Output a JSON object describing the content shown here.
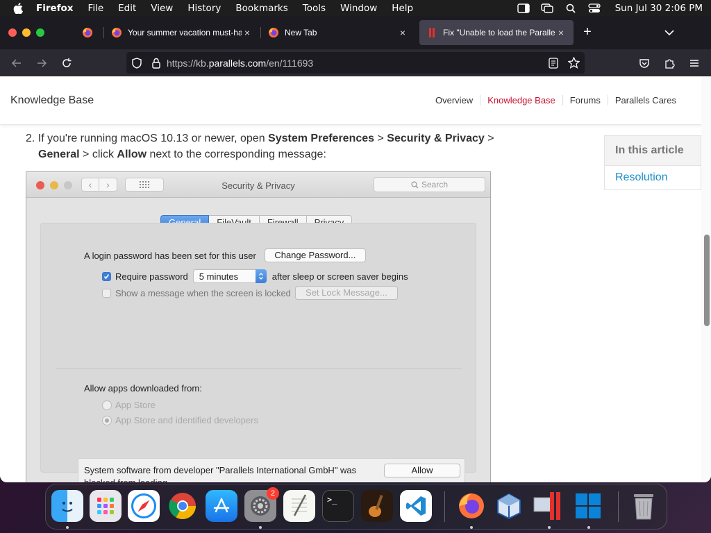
{
  "menubar": {
    "app_name": "Firefox",
    "items": [
      "File",
      "Edit",
      "View",
      "History",
      "Bookmarks",
      "Tools",
      "Window",
      "Help"
    ],
    "clock": "Sun Jul 30  2:06 PM"
  },
  "browser": {
    "tabs": [
      {
        "title": "Your summer vacation must-hav",
        "active": false
      },
      {
        "title": "New Tab",
        "active": false
      },
      {
        "title": "Fix \"Unable to load the Parallels",
        "active": true
      }
    ],
    "new_tab_symbol": "+",
    "tab_close_symbol": "×",
    "url": {
      "prefix": "https://kb.",
      "host": "parallels.com",
      "path": "/en/111693"
    }
  },
  "site": {
    "title": "Knowledge Base",
    "nav": [
      {
        "label": "Overview",
        "active": false
      },
      {
        "label": "Knowledge Base",
        "active": true
      },
      {
        "label": "Forums",
        "active": false
      },
      {
        "label": "Parallels Cares",
        "active": false
      }
    ],
    "accent_color": "#c8102e"
  },
  "article": {
    "step_number": "2.",
    "step_text_1": "If you're running macOS 10.13 or newer, open ",
    "step_bold_1": "System Preferences",
    "step_sep_1": " > ",
    "step_bold_2": "Security & Privacy",
    "step_sep_2": " > ",
    "step_bold_3": "General",
    "step_text_2": " > click ",
    "step_bold_4": "Allow",
    "step_text_3": " next to the corresponding message:"
  },
  "toc": {
    "heading": "In this article",
    "links": [
      "Resolution"
    ]
  },
  "screenshot": {
    "window_title": "Security & Privacy",
    "search_placeholder": "Search",
    "tabs": [
      "General",
      "FileVault",
      "Firewall",
      "Privacy"
    ],
    "selected_tab": "General",
    "login_password_text": "A login password has been set for this user",
    "change_password_button": "Change Password...",
    "require_password_label": "Require password",
    "require_password_value": "5 minutes",
    "after_sleep_text": "after sleep or screen saver begins",
    "show_message_label": "Show a message when the screen is locked",
    "set_lock_message_button": "Set Lock Message...",
    "allow_apps_label": "Allow apps downloaded from:",
    "radio_app_store": "App Store",
    "radio_identified": "App Store and identified developers",
    "notice_text": "System software from developer \"Parallels International GmbH\" was blocked from loading.",
    "allow_button": "Allow"
  },
  "dock": {
    "settings_badge": "2",
    "apps": [
      "finder-icon",
      "launchpad-icon",
      "safari-icon",
      "chrome-icon",
      "app-store-icon",
      "system-settings-icon",
      "textedit-icon",
      "terminal-icon",
      "garageband-icon",
      "vscode-icon",
      "firefox-icon",
      "virtualbox-icon",
      "parallels-icon",
      "windows-icon",
      "trash-icon"
    ]
  }
}
